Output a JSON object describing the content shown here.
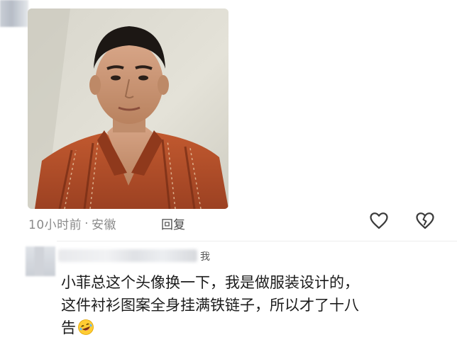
{
  "post": {
    "meta_time": "10小时前",
    "meta_sep": "·",
    "meta_location": "安徽",
    "reply_label": "回复",
    "like_icon": "heart-outline-icon",
    "dislike_icon": "broken-heart-icon"
  },
  "comment": {
    "author_suffix": "我",
    "text_line1": "小菲总这个头像换一下，我是做服装设计的，",
    "text_line2": "这件衬衫图案全身挂满铁链子，所以才了十八",
    "text_line3": "告",
    "emoji_icon": "rolling-laughing-emoji-icon"
  },
  "colors": {
    "shirt": "#b4502a",
    "meta_text": "#8a8a8a",
    "body_text": "#1b1b1b"
  }
}
